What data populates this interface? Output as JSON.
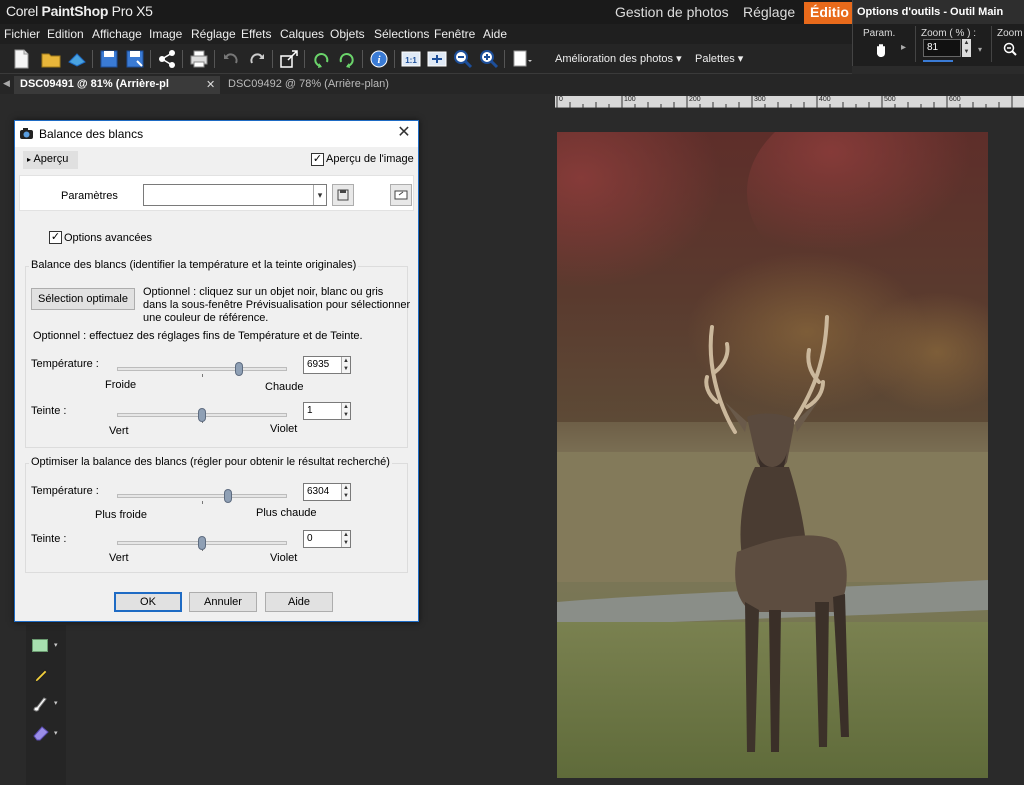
{
  "app": {
    "brand_prefix": "Corel ",
    "brand_bold": "PaintShop",
    "brand_suffix": " Pro X5",
    "workspace_tabs": [
      "Gestion de photos",
      "Réglage",
      "Éditio"
    ]
  },
  "menu": [
    "Fichier",
    "Edition",
    "Affichage",
    "Image",
    "Réglage",
    "Effets",
    "Calques",
    "Objets",
    "Sélections",
    "Fenêtre",
    "Aide"
  ],
  "toolbar": {
    "enhance_label": "Amélioration des photos ▾",
    "palettes_label": "Palettes ▾"
  },
  "tool_options": {
    "title": "Options d'outils - Outil Main",
    "param_label": "Param.",
    "zoom_label": "Zoom ( % ) :",
    "zoom_value": "81",
    "zoom2_label": "Zoom"
  },
  "doc_tabs": [
    {
      "label": "DSC09491 @  81% (Arrière-pl"
    },
    {
      "label": "DSC09492 @  78% (Arrière-plan)"
    }
  ],
  "ruler": [
    "0",
    "100",
    "200",
    "300",
    "400",
    "500",
    "600"
  ],
  "dialog": {
    "title": "Balance des blancs",
    "preview_toggle": "Aperçu",
    "image_preview_label": "Aperçu de l'image",
    "params_label": "Paramètres",
    "advanced_label": "Options avancées",
    "group1_title": "Balance des blancs (identifier la température et la teinte originales)",
    "optimal_button": "Sélection optimale",
    "optional_text_1": "Optionnel : cliquez sur un objet noir, blanc ou gris",
    "optional_text_2": "dans la sous-fenêtre Prévisualisation pour sélectionner",
    "optional_text_3": "une couleur de référence.",
    "optional_text_4": "Optionnel : effectuez des réglages fins de Température et de Teinte.",
    "temp_label": "Température :",
    "temp_min": "Froide",
    "temp_max": "Chaude",
    "temp_value": "6935",
    "tint_label": "Teinte :",
    "tint_min": "Vert",
    "tint_max": "Violet",
    "tint_value": "1",
    "group2_title": "Optimiser la balance des blancs (régler pour obtenir le résultat recherché)",
    "temp2_label": "Température :",
    "temp2_min": "Plus froide",
    "temp2_max": "Plus chaude",
    "temp2_value": "6304",
    "tint2_label": "Teinte :",
    "tint2_min": "Vert",
    "tint2_max": "Violet",
    "tint2_value": "0",
    "ok": "OK",
    "cancel": "Annuler",
    "help": "Aide"
  },
  "sliders": {
    "temp_fraction": 0.72,
    "tint_fraction": 0.5,
    "temp2_fraction": 0.65,
    "tint2_fraction": 0.5
  },
  "colors": {
    "accent_tab": "#e86a1b",
    "dialog_border": "#1e6bc4"
  }
}
